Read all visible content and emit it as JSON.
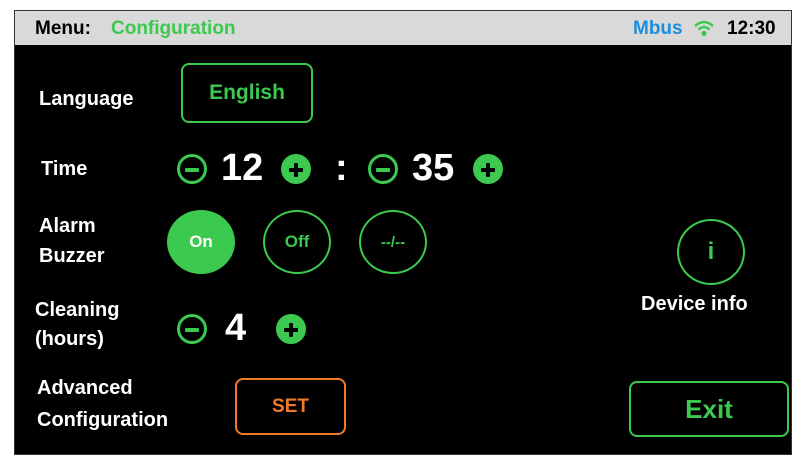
{
  "header": {
    "menu_label": "Menu:",
    "menu_title": "Configuration",
    "bus": "Mbus",
    "clock": "12:30",
    "wifi_icon": "wifi-icon"
  },
  "language": {
    "label": "Language",
    "value": "English"
  },
  "time": {
    "label": "Time",
    "hours": "12",
    "separator": ":",
    "minutes": "35"
  },
  "alarm": {
    "label_line1": "Alarm",
    "label_line2": "Buzzer",
    "options": [
      "On",
      "Off",
      "--/--"
    ],
    "selected": "On"
  },
  "cleaning": {
    "label_line1": "Cleaning",
    "label_line2": "(hours)",
    "value": "4"
  },
  "advanced": {
    "label_line1": "Advanced",
    "label_line2": "Configuration",
    "set_label": "SET"
  },
  "device_info": {
    "icon_label": "i",
    "label": "Device info"
  },
  "exit_label": "Exit",
  "colors": {
    "accent": "#3cc94f",
    "set": "#f07a2a",
    "bus": "#1a8fe0",
    "header_bg": "#d9d9d9"
  }
}
